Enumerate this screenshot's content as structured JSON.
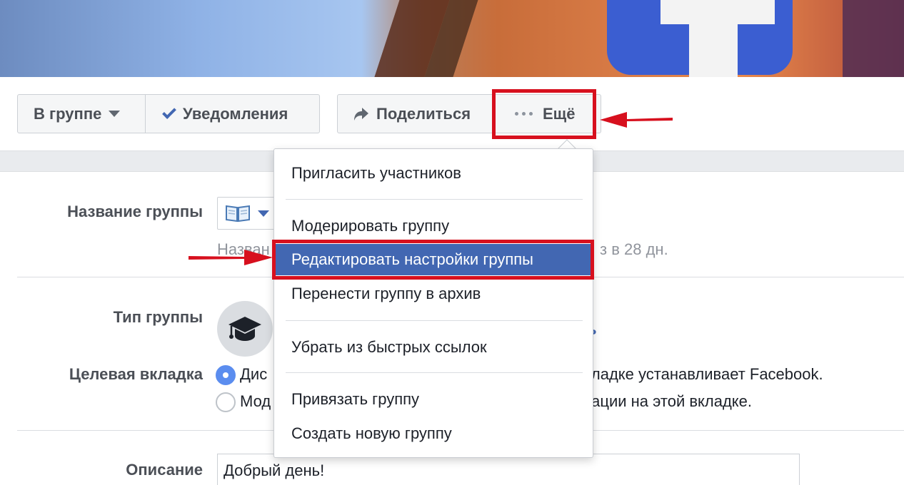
{
  "header": {
    "group_button": "В группе",
    "notifications_button": "Уведомления",
    "share_button": "Поделиться",
    "more_button": "Ещё"
  },
  "settings": {
    "group_name_label": "Название группы",
    "group_name_hint_left": "Назван",
    "group_name_hint_right": "з в 28 дн.",
    "group_type_label": "Тип группы",
    "group_type_link_fragment": "ь",
    "target_tab_label": "Целевая вкладка",
    "option1_left": "Дис",
    "option1_right": "кладке устанавливает Facebook.",
    "option2_left": "Мод",
    "option2_right": "кации на этой вкладке.",
    "description_label": "Описание",
    "description_value": "Добрый день!"
  },
  "menu": {
    "items": [
      "Пригласить участников",
      "Модерировать группу",
      "Редактировать настройки группы",
      "Перенести группу в архив",
      "Убрать из быстрых ссылок",
      "Привязать группу",
      "Создать новую группу"
    ],
    "active_index": 2
  },
  "colors": {
    "highlight": "#d7101e",
    "menu_active": "#4267b2",
    "radio_selected": "#5b8def"
  },
  "icons": [
    "caret-down-icon",
    "checkmark-icon",
    "share-arrow-icon",
    "more-dots-icon",
    "book-emoji-icon",
    "graduation-cap-icon"
  ]
}
